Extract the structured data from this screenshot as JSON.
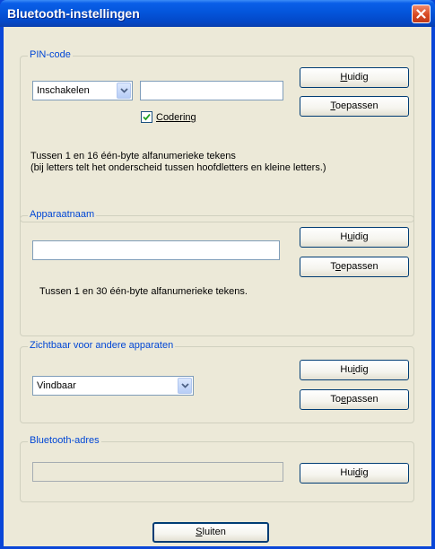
{
  "window": {
    "title": "Bluetooth-instellingen",
    "close_icon": "close-icon"
  },
  "pin": {
    "legend": "PIN-code",
    "mode_value": "Inschakelen",
    "code_value": "",
    "encryption_label": "Codering",
    "encryption_checked": true,
    "info_line1": "Tussen 1 en 16 één-byte alfanumerieke tekens",
    "info_line2": "(bij letters telt het onderscheid tussen hoofdletters en kleine letters.)",
    "current_pre": "",
    "current_key": "H",
    "current_post": "uidig",
    "apply_pre": "",
    "apply_key": "T",
    "apply_post": "oepassen"
  },
  "device_name": {
    "legend": "Apparaatnaam",
    "value": "",
    "info": "Tussen 1 en 30 één-byte alfanumerieke tekens.",
    "current_pre": "H",
    "current_key": "u",
    "current_post": "idig",
    "apply_pre": "T",
    "apply_key": "o",
    "apply_post": "epassen"
  },
  "visibility": {
    "legend": "Zichtbaar voor andere apparaten",
    "value": "Vindbaar",
    "current_pre": "Hu",
    "current_key": "i",
    "current_post": "dig",
    "apply_pre": "To",
    "apply_key": "e",
    "apply_post": "passen"
  },
  "address": {
    "legend": "Bluetooth-adres",
    "value": "",
    "current_pre": "Hui",
    "current_key": "d",
    "current_post": "ig"
  },
  "footer": {
    "close_pre": "",
    "close_key": "S",
    "close_post": "luiten"
  }
}
